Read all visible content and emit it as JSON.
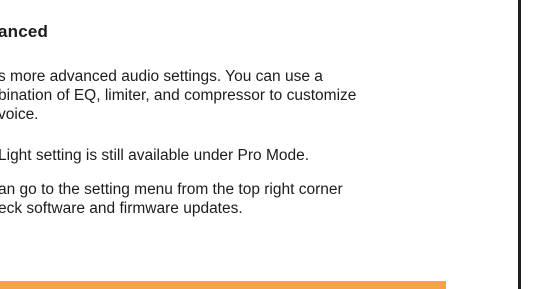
{
  "section": {
    "heading": "anced",
    "paragraphs": [
      {
        "lines": [
          "s more advanced audio settings. You can use a",
          "bination of EQ, limiter, and compressor to customize",
          "voice."
        ]
      },
      {
        "lines": [
          "Light setting is still available under Pro Mode."
        ]
      },
      {
        "lines": [
          "an go to the setting menu from the top right corner",
          "eck software and firmware updates."
        ]
      }
    ]
  },
  "footer": {
    "accent_color": "#f5a24c"
  },
  "frame": {
    "border_color": "#1e1e1e"
  }
}
